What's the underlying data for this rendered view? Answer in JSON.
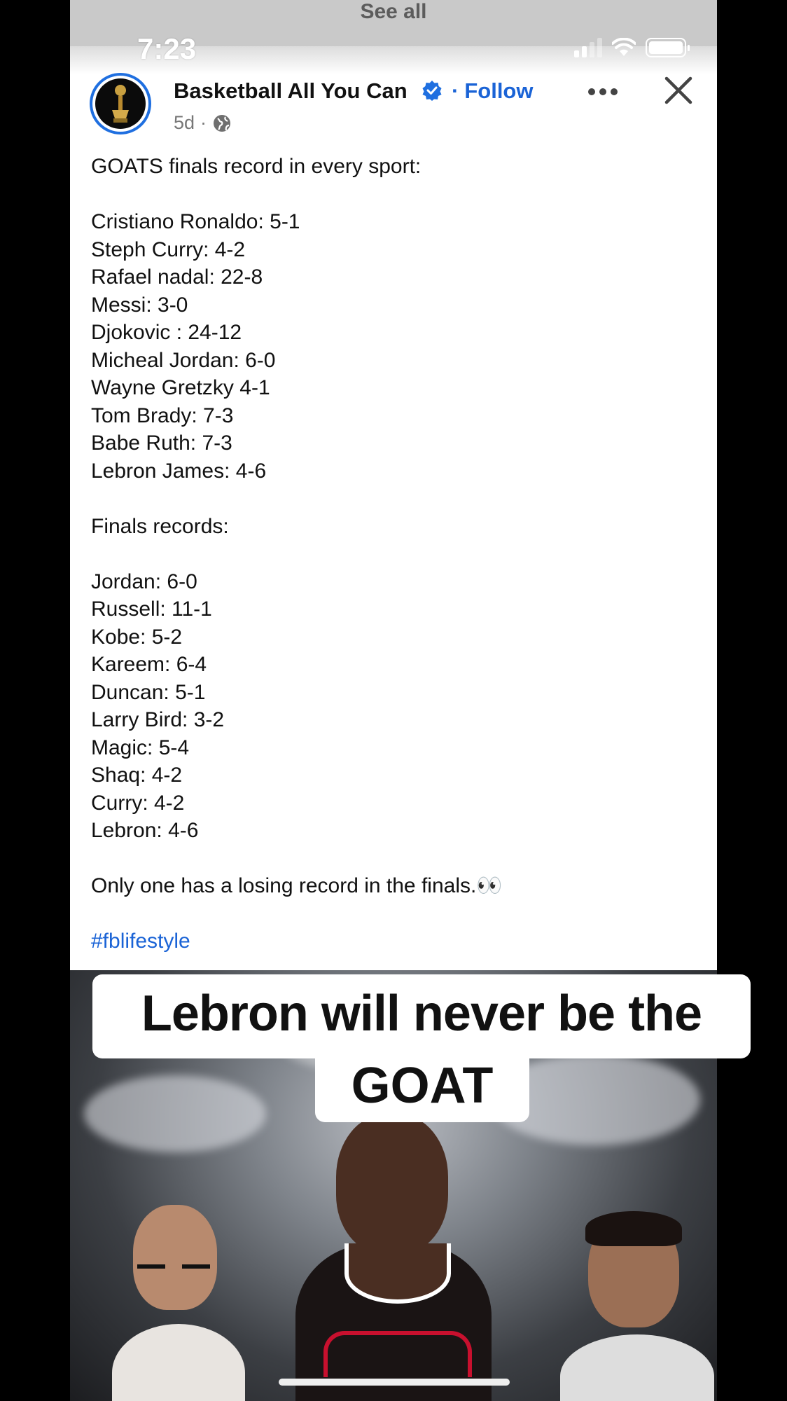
{
  "see_all": "See all",
  "status": {
    "time": "7:23"
  },
  "post": {
    "page_name": "Basketball All You Can",
    "follow_separator": "·",
    "follow_label": "Follow",
    "age": "5d",
    "meta_separator": "·",
    "lines": [
      "GOATS finals record in every sport:",
      "",
      "Cristiano Ronaldo: 5-1",
      "Steph Curry: 4-2",
      "Rafael nadal: 22-8",
      "Messi: 3-0",
      "Djokovic : 24-12",
      "Micheal Jordan: 6-0",
      "Wayne Gretzky 4-1",
      "Tom Brady: 7-3",
      "Babe Ruth: 7-3",
      "Lebron James: 4-6",
      "",
      "Finals records:",
      "",
      "Jordan: 6-0",
      "Russell: 11-1",
      "Kobe: 5-2",
      "Kareem: 6-4",
      "Duncan: 5-1",
      "Larry Bird: 3-2",
      "Magic: 5-4",
      "Shaq: 4-2",
      "Curry: 4-2",
      "Lebron: 4-6",
      "",
      "Only one has a losing record in the finals.👀",
      ""
    ],
    "hashtag": "#fblifestyle"
  },
  "overlay_caption": {
    "line1": "Lebron will never be the",
    "line2": "GOAT"
  },
  "colors": {
    "link_blue": "#1a63d6",
    "avatar_ring": "#1f6fe0",
    "text": "#111111"
  }
}
